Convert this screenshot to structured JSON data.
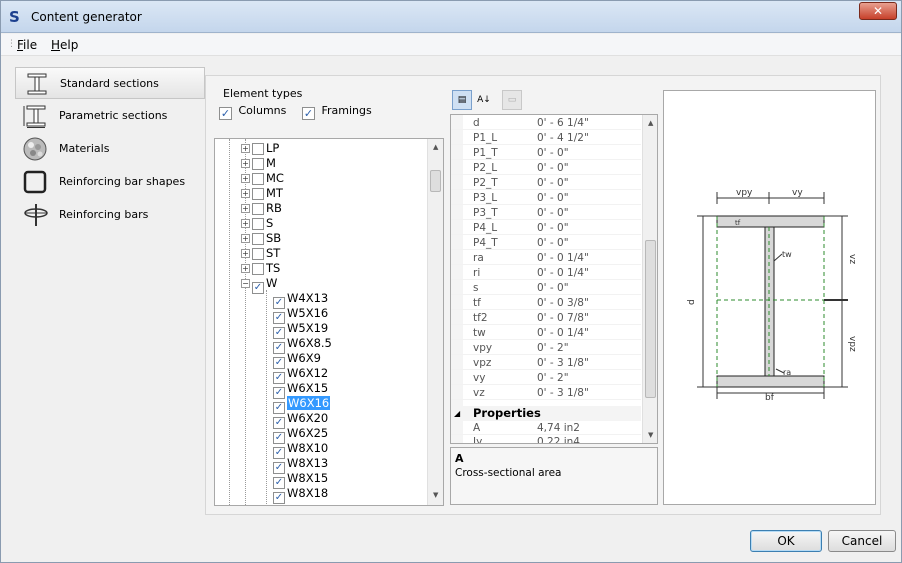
{
  "window": {
    "app_icon": "S",
    "title": "Content generator",
    "close_glyph": "✕"
  },
  "menu": [
    {
      "label": "File",
      "underline": "F",
      "rest": "ile"
    },
    {
      "label": "Help",
      "underline": "H",
      "rest": "elp"
    }
  ],
  "sidebar": {
    "items": [
      {
        "label": "Standard sections",
        "icon": "i-beam-section-icon",
        "active": true
      },
      {
        "label": "Parametric sections",
        "icon": "parametric-section-icon",
        "active": false
      },
      {
        "label": "Materials",
        "icon": "materials-sphere-icon",
        "active": false
      },
      {
        "label": "Reinforcing bar shapes",
        "icon": "rebar-shape-icon",
        "active": false
      },
      {
        "label": "Reinforcing bars",
        "icon": "rebar-icon",
        "active": false
      }
    ]
  },
  "element_types": {
    "group_label": "Element types",
    "columns": {
      "label": "Columns",
      "checked": true
    },
    "framings": {
      "label": "Framings",
      "checked": true
    }
  },
  "tree": {
    "families": [
      {
        "label": "LP",
        "expanded": false,
        "checked": false
      },
      {
        "label": "M",
        "expanded": false,
        "checked": false
      },
      {
        "label": "MC",
        "expanded": false,
        "checked": false
      },
      {
        "label": "MT",
        "expanded": false,
        "checked": false
      },
      {
        "label": "RB",
        "expanded": false,
        "checked": false
      },
      {
        "label": "S",
        "expanded": false,
        "checked": false
      },
      {
        "label": "SB",
        "expanded": false,
        "checked": false
      },
      {
        "label": "ST",
        "expanded": false,
        "checked": false
      },
      {
        "label": "TS",
        "expanded": false,
        "checked": false
      },
      {
        "label": "W",
        "expanded": true,
        "checked": true
      }
    ],
    "w_children": [
      "W4X13",
      "W5X16",
      "W5X19",
      "W6X8.5",
      "W6X9",
      "W6X12",
      "W6X15",
      "W6X16",
      "W6X20",
      "W6X25",
      "W8X10",
      "W8X13",
      "W8X15",
      "W8X18"
    ],
    "selected": "W6X16"
  },
  "properties": {
    "rows": [
      {
        "name": "d",
        "value": "0' - 6 1/4\""
      },
      {
        "name": "P1_L",
        "value": "0' - 4 1/2\""
      },
      {
        "name": "P1_T",
        "value": "0' - 0\""
      },
      {
        "name": "P2_L",
        "value": "0' - 0\""
      },
      {
        "name": "P2_T",
        "value": "0' - 0\""
      },
      {
        "name": "P3_L",
        "value": "0' - 0\""
      },
      {
        "name": "P3_T",
        "value": "0' - 0\""
      },
      {
        "name": "P4_L",
        "value": "0' - 0\""
      },
      {
        "name": "P4_T",
        "value": "0' - 0\""
      },
      {
        "name": "ra",
        "value": "0' - 0 1/4\""
      },
      {
        "name": "ri",
        "value": "0' - 0 1/4\""
      },
      {
        "name": "s",
        "value": "0' - 0\""
      },
      {
        "name": "tf",
        "value": "0' - 0 3/8\""
      },
      {
        "name": "tf2",
        "value": "0' - 0 7/8\""
      },
      {
        "name": "tw",
        "value": "0' - 0 1/4\""
      },
      {
        "name": "vpy",
        "value": "0' - 2\""
      },
      {
        "name": "vpz",
        "value": "0' - 3 1/8\""
      },
      {
        "name": "vy",
        "value": "0' - 2\""
      },
      {
        "name": "vz",
        "value": "0' - 3 1/8\""
      }
    ],
    "category": "Properties",
    "category_rows": [
      {
        "name": "A",
        "value": "4,74 in2"
      },
      {
        "name": "Iy",
        "value": "0,22 in4"
      }
    ],
    "description_title": "A",
    "description_text": "Cross-sectional area"
  },
  "preview": {
    "labels": {
      "vpy": "vpy",
      "vy": "vy",
      "tf": "tf",
      "tw": "tw",
      "vz": "vz",
      "vpz": "vpz",
      "d": "d",
      "bf": "bf",
      "ra": "ra"
    }
  },
  "buttons": {
    "ok": "OK",
    "cancel": "Cancel"
  },
  "colors": {
    "selection": "#3399ff",
    "check": "#2b5fab",
    "axis_green": "#2e8b2e"
  }
}
